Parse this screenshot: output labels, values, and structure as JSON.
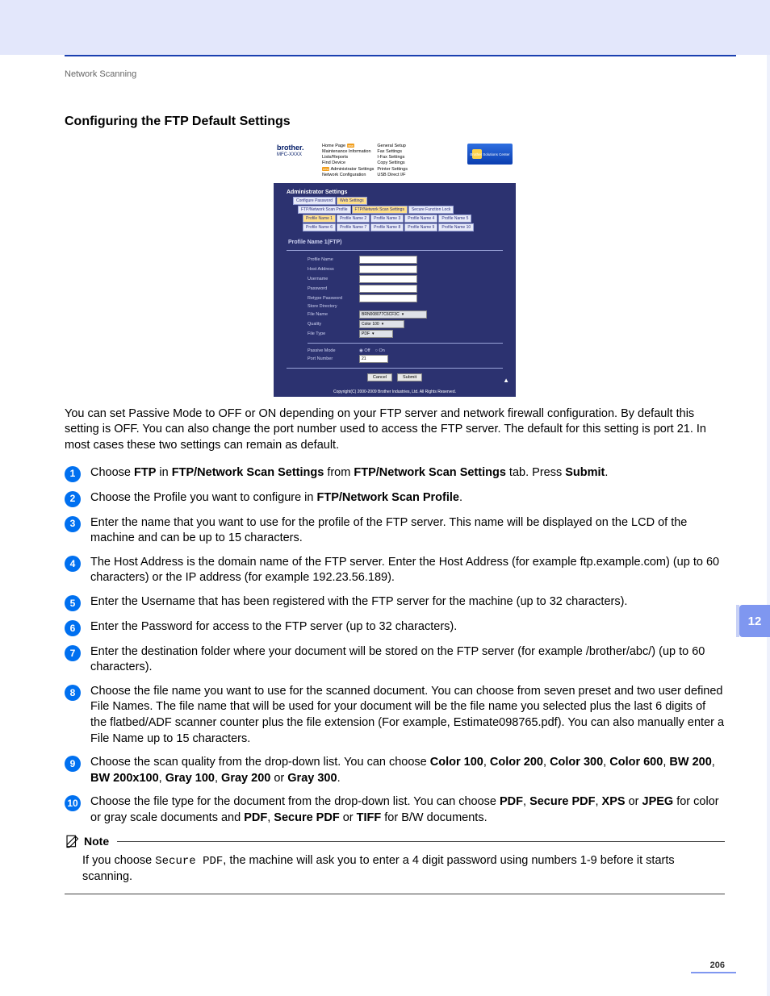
{
  "header": {
    "section": "Network Scanning"
  },
  "title": "Configuring the FTP Default Settings",
  "chapter": "12",
  "page_number": "206",
  "shot": {
    "brand": "brother.",
    "model": "MFC-XXXX",
    "new": "new",
    "solutions": "Brother Solutions Center",
    "nav": {
      "col1": [
        "Home Page",
        "Maintenance Information",
        "Lists/Reports",
        "Find Device",
        "Administrator Settings",
        "Network Configuration"
      ],
      "col2": [
        "General Setup",
        "Fax Settings",
        "I-Fax Settings",
        "Copy Settings",
        "Printer Settings",
        "USB Direct I/F"
      ]
    },
    "admin_title": "Administrator Settings",
    "tabs1": [
      "Configure Password",
      "Web Settings"
    ],
    "tabs2": [
      "FTP/Network Scan Profile",
      "FTP/Network Scan Settings",
      "Secure Function Lock"
    ],
    "tabs3": [
      "Profile Name 1",
      "Profile Name 2",
      "Profile Name 3",
      "Profile Name 4",
      "Profile Name 5"
    ],
    "tabs4": [
      "Profile Name 6",
      "Profile Name 7",
      "Profile Name 8",
      "Profile Name 9",
      "Profile Name 10"
    ],
    "profile_heading": "Profile Name 1(FTP)",
    "fields": {
      "profile_name": "Profile Name",
      "host_address": "Host Address",
      "username": "Username",
      "password": "Password",
      "retype_password": "Retype Password",
      "store_directory": "Store Directory",
      "file_name": "File Name",
      "quality": "Quality",
      "file_type": "File Type",
      "passive_mode": "Passive Mode",
      "port_number": "Port Number"
    },
    "values": {
      "file_name": "BRN008077C6CF3C",
      "quality": "Color 100",
      "file_type": "PDF",
      "passive_off": "Off",
      "passive_on": "On",
      "port": "21"
    },
    "buttons": {
      "cancel": "Cancel",
      "submit": "Submit"
    },
    "copyright": "Copyright(C) 2000-2009 Brother Industries, Ltd. All Rights Reserved."
  },
  "intro": "You can set Passive Mode to OFF or ON depending on your FTP server and network firewall configuration. By default this setting is OFF. You can also change the port number used to access the FTP server. The default for this setting is port 21. In most cases these two settings can remain as default.",
  "s1": {
    "b1": "FTP",
    "b2": "FTP/Network Scan Settings",
    "b3": "FTP/Network Scan Settings",
    "b4": "Submit"
  },
  "s2": {
    "b1": "FTP/Network Scan Profile"
  },
  "s3": {
    "t": "Enter the name that you want to use for the profile of the FTP server. This name will be displayed on the LCD of the machine and can be up to 15 characters."
  },
  "s4": {
    "t": "The Host Address is the domain name of the FTP server. Enter the Host Address (for example ftp.example.com) (up to 60 characters) or the IP address (for example 192.23.56.189)."
  },
  "s5": {
    "t": "Enter the Username that has been registered with the FTP server for the machine (up to 32 characters)."
  },
  "s6": {
    "t": "Enter the Password for access to the FTP server (up to 32 characters)."
  },
  "s7": {
    "t": "Enter the destination folder where your document will be stored on the FTP server (for example /brother/abc/) (up to 60 characters)."
  },
  "s8": {
    "t": "Choose the file name you want to use for the scanned document. You can choose from seven preset and two user defined File Names. The file name that will be used for your document will be the file name you selected plus the last 6 digits of the flatbed/ADF scanner counter plus the file extension (For example, Estimate098765.pdf). You can also manually enter a File Name up to 15 characters."
  },
  "s9": {
    "b": [
      "Color 100",
      "Color 200",
      "Color 300",
      "Color 600",
      "BW 200",
      "BW 200x100",
      "Gray 100",
      "Gray 200",
      "Gray 300"
    ]
  },
  "s10": {
    "b": [
      "PDF",
      "Secure PDF",
      "XPS",
      "JPEG",
      "PDF",
      "Secure PDF",
      "TIFF"
    ]
  },
  "note": {
    "label": "Note",
    "code": "Secure PDF"
  }
}
